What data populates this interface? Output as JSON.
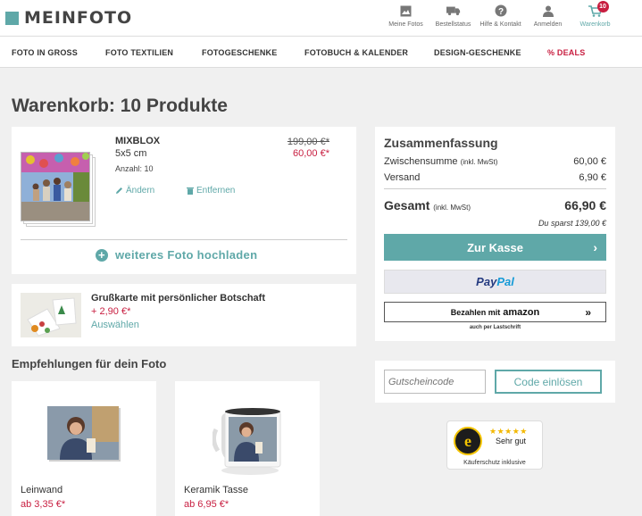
{
  "header": {
    "logo": "MEINFOTO",
    "icons": [
      {
        "label": "Meine Fotos",
        "icon": "photos-icon"
      },
      {
        "label": "Bestellstatus",
        "icon": "truck-icon"
      },
      {
        "label": "Hilfe & Kontakt",
        "icon": "help-icon"
      },
      {
        "label": "Anmelden",
        "icon": "user-icon"
      },
      {
        "label": "Warenkorb",
        "icon": "cart-icon",
        "badge": "10"
      }
    ]
  },
  "nav": [
    "FOTO IN GROSS",
    "FOTO TEXTILIEN",
    "FOTOGESCHENKE",
    "FOTOBUCH & KALENDER",
    "DESIGN-GESCHENKE",
    "% DEALS"
  ],
  "page_title": "Warenkorb: 10 Produkte",
  "product": {
    "name": "MIXBLOX",
    "size": "5x5 cm",
    "qty": "Anzahl: 10",
    "price_old": "199,00 €*",
    "price_new": "60,00 €*",
    "edit": "Ändern",
    "remove": "Entfernen",
    "upload": "weiteres Foto hochladen"
  },
  "greeting": {
    "title": "Grußkarte mit persönlicher Botschaft",
    "price": "+ 2,90 €*",
    "select": "Auswählen"
  },
  "recommendations": {
    "title": "Empfehlungen für dein Foto",
    "items": [
      {
        "name": "Leinwand",
        "price": "ab 3,35 €*"
      },
      {
        "name": "Keramik Tasse",
        "price": "ab 6,95 €*"
      }
    ]
  },
  "summary": {
    "title": "Zusammenfassung",
    "subtotal_label": "Zwischensumme",
    "subtotal_note": "(inkl. MwSt)",
    "subtotal": "60,00 €",
    "shipping_label": "Versand",
    "shipping": "6,90 €",
    "total_label": "Gesamt",
    "total_note": "(inkl. MwSt)",
    "total": "66,90 €",
    "saved": "Du sparst 139,00 €",
    "checkout": "Zur Kasse",
    "paypal_a": "Pay",
    "paypal_b": "Pal",
    "amazon_prefix": "Bezahlen mit",
    "amazon_brand": "amazon",
    "amazon_note": "auch per Lastschrift"
  },
  "voucher": {
    "placeholder": "Gutscheincode",
    "button": "Code einlösen"
  },
  "trust": {
    "stars": "★★★★★",
    "rating": "Sehr gut",
    "note": "Käuferschutz inklusive",
    "seal_letter": "e"
  },
  "colors": {
    "accent": "#5fa8a8",
    "price_red": "#c81e40",
    "background": "#f0f0f0"
  }
}
